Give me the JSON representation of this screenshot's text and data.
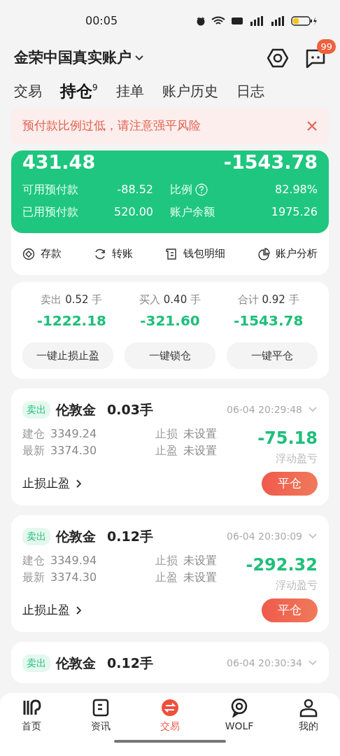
{
  "status_bar": {
    "time": "00:05"
  },
  "header": {
    "account": "金荣中国真实账户",
    "badge": "99"
  },
  "tabs": [
    {
      "label": "交易",
      "selected": false
    },
    {
      "label": "持仓",
      "count": "9",
      "selected": true
    },
    {
      "label": "挂单",
      "selected": false
    },
    {
      "label": "账户历史",
      "selected": false
    },
    {
      "label": "日志",
      "selected": false
    }
  ],
  "alert": {
    "text": "预付款比例过低，请注意强平风险"
  },
  "account": {
    "equity": "431.48",
    "profit": "-1543.78",
    "stats": [
      {
        "label": "可用预付款",
        "value": "-88.52",
        "help": false
      },
      {
        "label": "比例",
        "value": "82.98%",
        "help": true
      },
      {
        "label": "已用预付款",
        "value": "520.00",
        "help": false
      },
      {
        "label": "账户余额",
        "value": "1975.26",
        "help": false
      }
    ]
  },
  "actions": [
    {
      "kind": "deposit",
      "label": "存款"
    },
    {
      "kind": "transfer",
      "label": "转账"
    },
    {
      "kind": "wallet",
      "label": "钱包明细"
    },
    {
      "kind": "analysis",
      "label": "账户分析"
    }
  ],
  "summary": {
    "columns": [
      {
        "label": "卖出",
        "lots": "0.52",
        "unit": "手",
        "value": "-1222.18"
      },
      {
        "label": "买入",
        "lots": "0.40",
        "unit": "手",
        "value": "-321.60"
      },
      {
        "label": "合计",
        "lots": "0.92",
        "unit": "手",
        "value": "-1543.78"
      }
    ],
    "buttons": [
      "一键止损止盈",
      "一键锁仓",
      "一键平仓"
    ]
  },
  "positions": [
    {
      "side": "卖出",
      "symbol": "伦敦金",
      "lots": "0.03手",
      "time": "06-04 20:29:48",
      "open_label": "建仓",
      "open": "3349.24",
      "latest_label": "最新",
      "latest": "3374.30",
      "sl_label": "止损",
      "sl": "未设置",
      "tp_label": "止盈",
      "tp": "未设置",
      "pnl": "-75.18",
      "pnl_label": "浮动盈亏",
      "sltp_link": "止损止盈",
      "close_button": "平仓"
    },
    {
      "side": "卖出",
      "symbol": "伦敦金",
      "lots": "0.12手",
      "time": "06-04 20:30:09",
      "open_label": "建仓",
      "open": "3349.94",
      "latest_label": "最新",
      "latest": "3374.30",
      "sl_label": "止损",
      "sl": "未设置",
      "tp_label": "止盈",
      "tp": "未设置",
      "pnl": "-292.32",
      "pnl_label": "浮动盈亏",
      "sltp_link": "止损止盈",
      "close_button": "平仓"
    },
    {
      "side": "卖出",
      "symbol": "伦敦金",
      "lots": "0.12手",
      "time": "06-04 20:30:34"
    }
  ],
  "nav": [
    {
      "kind": "home",
      "label": "首页",
      "selected": false
    },
    {
      "kind": "news",
      "label": "资讯",
      "selected": false
    },
    {
      "kind": "trade",
      "label": "交易",
      "selected": true
    },
    {
      "kind": "wolf",
      "label": "WOLF",
      "selected": false
    },
    {
      "kind": "me",
      "label": "我的",
      "selected": false
    }
  ]
}
